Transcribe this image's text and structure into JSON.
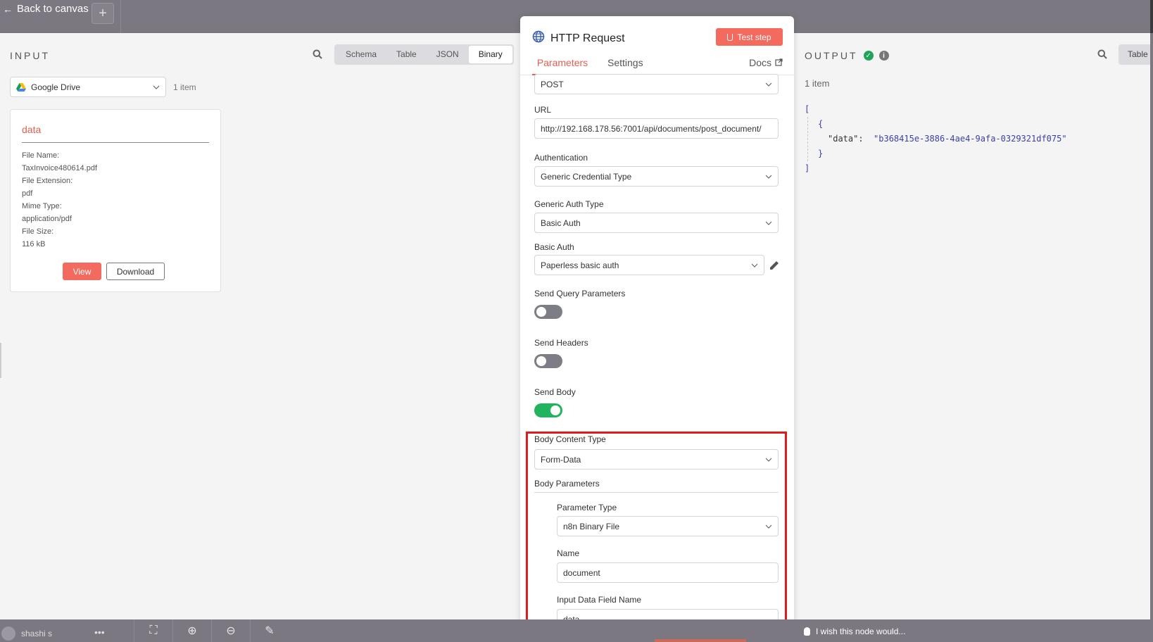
{
  "topbar": {
    "back_label": "Back to canvas",
    "add_label": "+"
  },
  "input": {
    "title": "INPUT",
    "views": [
      "Schema",
      "Table",
      "JSON",
      "Binary"
    ],
    "active_view": "Binary",
    "source": "Google Drive",
    "item_count": "1 item",
    "card": {
      "title": "data",
      "meta": [
        "File Name:",
        "TaxInvoice480614.pdf",
        "File Extension:",
        "pdf",
        "Mime Type:",
        "application/pdf",
        "File Size:",
        "116 kB"
      ],
      "view_label": "View",
      "download_label": "Download"
    }
  },
  "node": {
    "title": "HTTP Request",
    "test_step_label": "Test step",
    "tabs": {
      "parameters": "Parameters",
      "settings": "Settings",
      "docs": "Docs"
    },
    "method": "POST",
    "url_label": "URL",
    "url_value": "http://192.168.178.56:7001/api/documents/post_document/",
    "auth_label": "Authentication",
    "auth_value": "Generic Credential Type",
    "generic_auth_label": "Generic Auth Type",
    "generic_auth_value": "Basic Auth",
    "basic_auth_label": "Basic Auth",
    "basic_auth_value": "Paperless basic auth",
    "send_query_label": "Send Query Parameters",
    "send_query_on": false,
    "send_headers_label": "Send Headers",
    "send_headers_on": false,
    "send_body_label": "Send Body",
    "send_body_on": true,
    "body_content_type_label": "Body Content Type",
    "body_content_type_value": "Form-Data",
    "body_params_label": "Body Parameters",
    "param_type_label": "Parameter Type",
    "param_type_value": "n8n Binary File",
    "name_label": "Name",
    "name_value": "document",
    "input_field_label": "Input Data Field Name",
    "input_field_value": "data"
  },
  "output": {
    "title": "OUTPUT",
    "table_tab": "Table",
    "item_count": "1 item",
    "json": {
      "open_bracket": "[",
      "open_brace": "{",
      "key": "\"data\":",
      "value": "\"b368415e-3886-4ae4-9afa-0329321df075\"",
      "close_brace": "}",
      "close_bracket": "]"
    }
  },
  "bottombar": {
    "user": "shashi s",
    "dots": "•••",
    "wish": "I wish this node would..."
  },
  "colors": {
    "accent": "#f26b5e",
    "success": "#21b35e",
    "highlight": "#e01b1b"
  }
}
